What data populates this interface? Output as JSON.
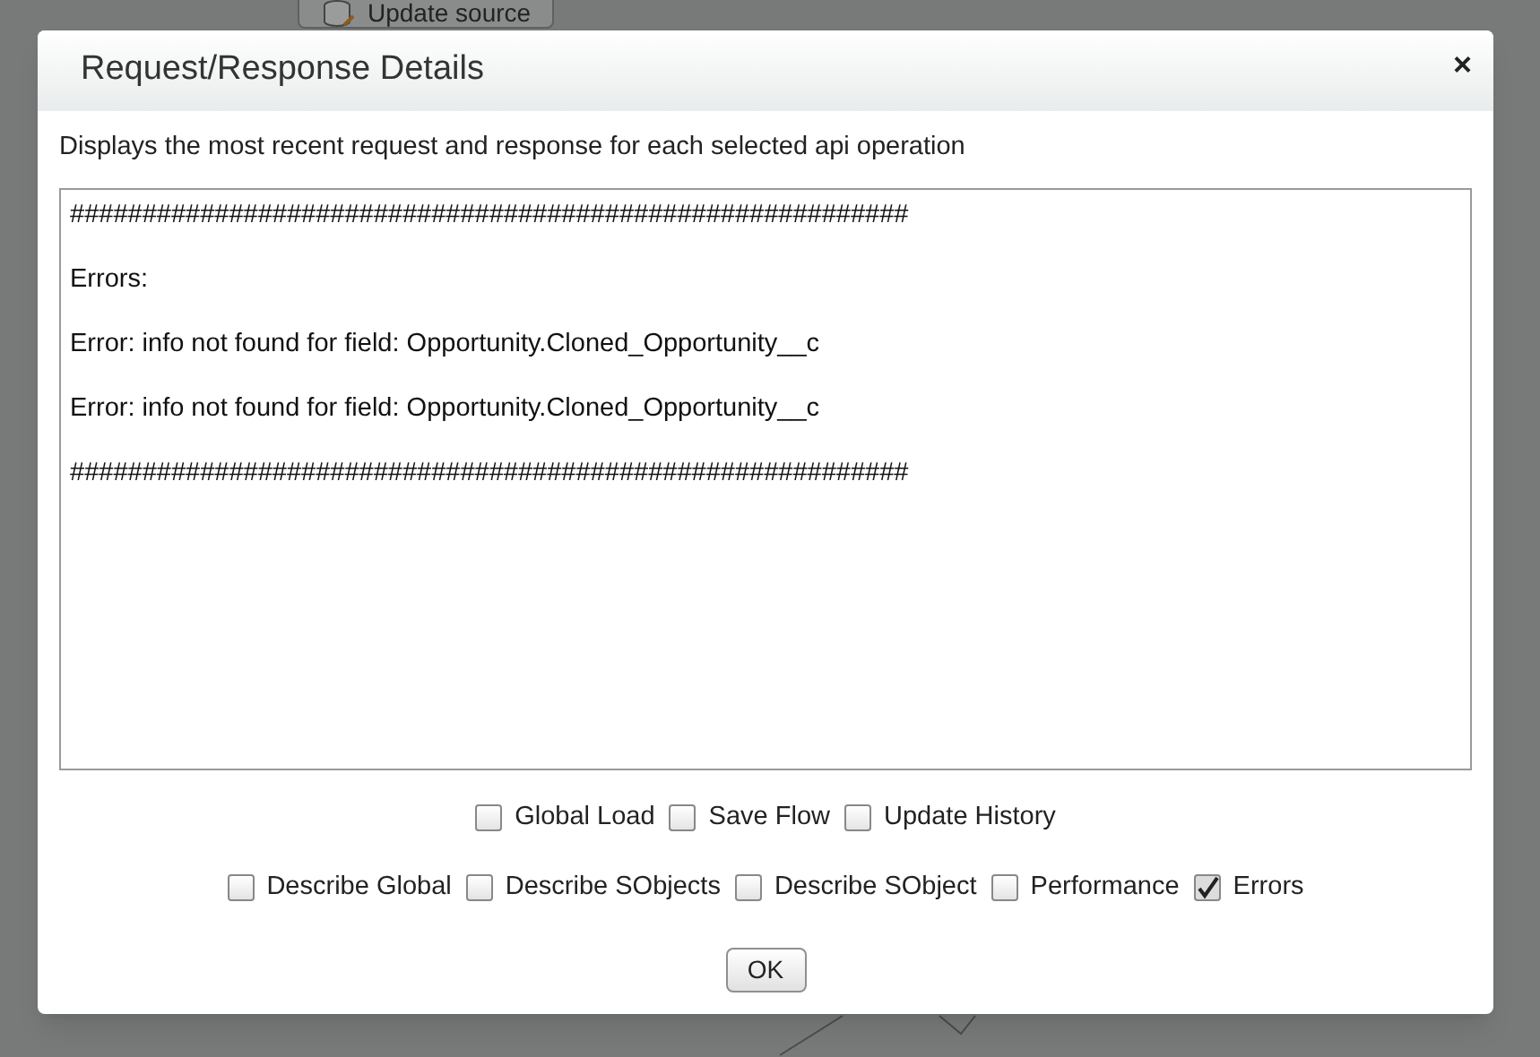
{
  "background": {
    "node": {
      "label": "Update source"
    }
  },
  "dialog": {
    "title": "Request/Response Details",
    "close": "×",
    "description": "Displays the most recent request and response for each selected api operation",
    "log_lines": [
      "##########################################################",
      "Errors:",
      "Error: info not found for field: Opportunity.Cloned_Opportunity__c",
      "Error: info not found for field: Opportunity.Cloned_Opportunity__c",
      "##########################################################"
    ],
    "option_rows": [
      [
        {
          "label": "Global Load",
          "checked": false
        },
        {
          "label": "Save Flow",
          "checked": false
        },
        {
          "label": "Update History",
          "checked": false
        }
      ],
      [
        {
          "label": "Describe Global",
          "checked": false
        },
        {
          "label": "Describe SObjects",
          "checked": false
        },
        {
          "label": "Describe SObject",
          "checked": false
        },
        {
          "label": "Performance",
          "checked": false
        },
        {
          "label": "Errors",
          "checked": true
        }
      ]
    ],
    "buttons": [
      "OK"
    ]
  }
}
